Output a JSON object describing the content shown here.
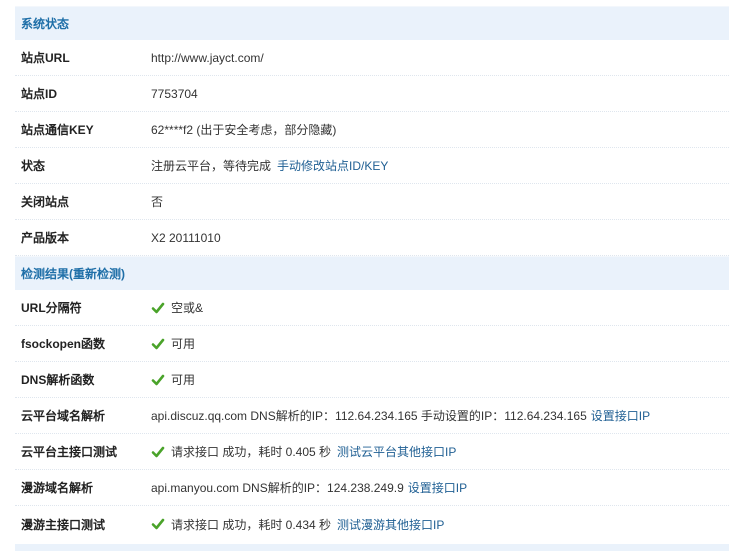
{
  "sections": {
    "system": {
      "title": "系统状态"
    },
    "check": {
      "title": "检测结果(重新检测)"
    }
  },
  "system_rows": [
    {
      "label": "站点URL",
      "value": "http://www.jayct.com/"
    },
    {
      "label": "站点ID",
      "value": "7753704"
    },
    {
      "label": "站点通信KEY",
      "value": "62****f2 (出于安全考虑，部分隐藏)"
    },
    {
      "label": "状态",
      "value": "注册云平台，等待完成",
      "link": "手动修改站点ID/KEY"
    },
    {
      "label": "关闭站点",
      "value": "否"
    },
    {
      "label": "产品版本",
      "value": "X2 20111010"
    }
  ],
  "check_rows": [
    {
      "label": "URL分隔符",
      "value": "空或&",
      "icon": "check-icon"
    },
    {
      "label": "fsockopen函数",
      "value": "可用",
      "icon": "check-icon"
    },
    {
      "label": "DNS解析函数",
      "value": "可用",
      "icon": "check-icon"
    },
    {
      "label": "云平台域名解析",
      "value": "api.discuz.qq.com DNS解析的IP：112.64.234.165 手动设置的IP：112.64.234.165",
      "link": "设置接口IP"
    },
    {
      "label": "云平台主接口测试",
      "value": "请求接口 成功，耗时 0.405 秒",
      "link": "测试云平台其他接口IP",
      "icon": "check-icon"
    },
    {
      "label": "漫游域名解析",
      "value": "api.manyou.com DNS解析的IP：124.238.249.9",
      "link": "设置接口IP"
    },
    {
      "label": "漫游主接口测试",
      "value": "请求接口 成功，耗时 0.434 秒",
      "link": "测试漫游其他接口IP",
      "icon": "check-icon"
    }
  ],
  "colors": {
    "section_bg": "#eaf2fb",
    "section_text": "#1f6fa8",
    "link": "#1f5f93",
    "check": "#4aa32a"
  }
}
